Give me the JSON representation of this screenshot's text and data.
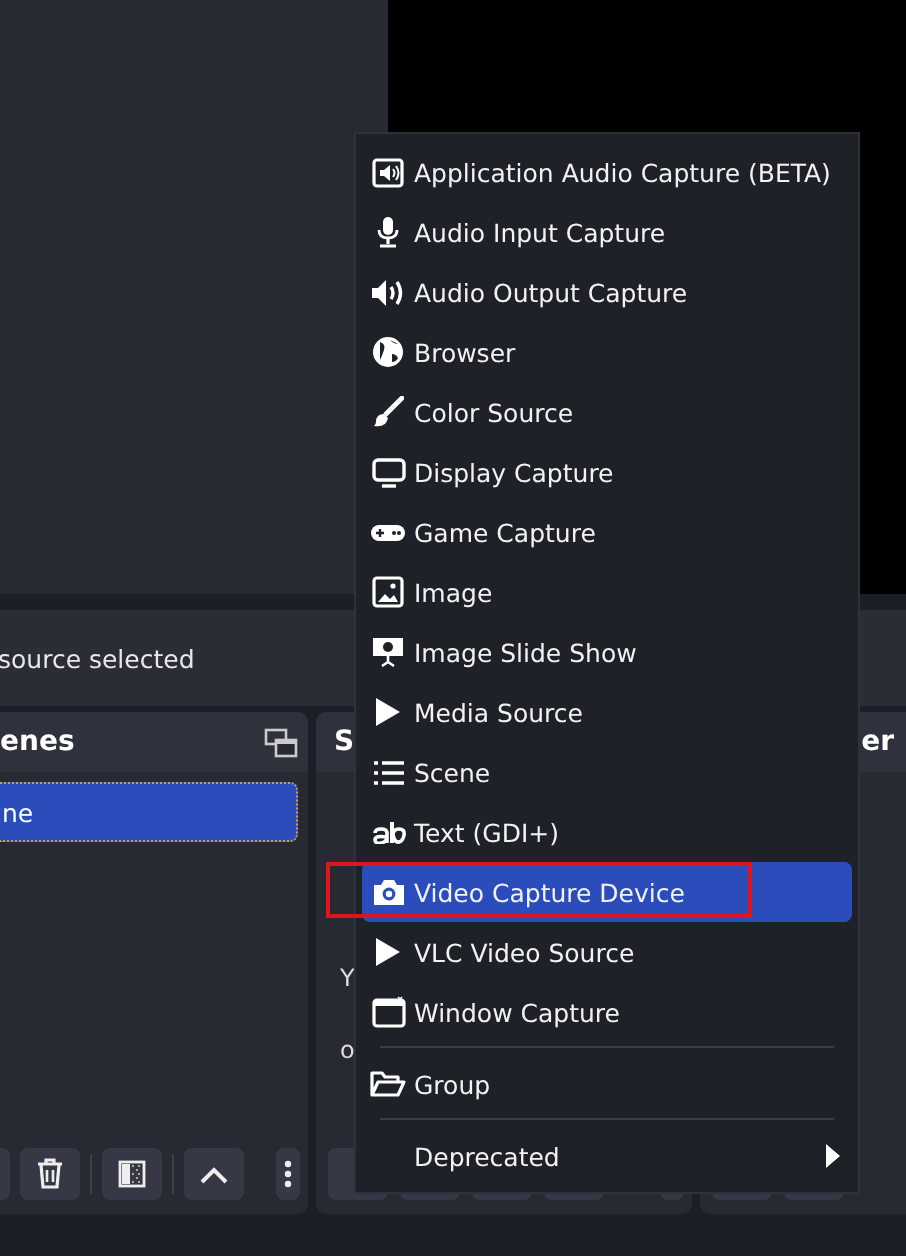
{
  "status": {
    "text": "source selected"
  },
  "panels": [
    {
      "kind": "scenes",
      "title": "enes",
      "items": [
        {
          "label": "ne",
          "selected": true
        }
      ]
    },
    {
      "kind": "sources",
      "title": "S",
      "lines": [
        "Y",
        "o"
      ]
    },
    {
      "kind": "mixer",
      "title": "er"
    }
  ],
  "menu": {
    "items": [
      {
        "kind": "item",
        "label": "Application Audio Capture (BETA)",
        "selected": false,
        "marked": false
      },
      {
        "kind": "item",
        "label": "Audio Input Capture",
        "selected": false,
        "marked": false
      },
      {
        "kind": "item",
        "label": "Audio Output Capture",
        "selected": false,
        "marked": false
      },
      {
        "kind": "item",
        "label": "Browser",
        "selected": false,
        "marked": false
      },
      {
        "kind": "item",
        "label": "Color Source",
        "selected": false,
        "marked": false
      },
      {
        "kind": "item",
        "label": "Display Capture",
        "selected": false,
        "marked": false
      },
      {
        "kind": "item",
        "label": "Game Capture",
        "selected": false,
        "marked": false
      },
      {
        "kind": "item",
        "label": "Image",
        "selected": false,
        "marked": false
      },
      {
        "kind": "item",
        "label": "Image Slide Show",
        "selected": false,
        "marked": false
      },
      {
        "kind": "item",
        "label": "Media Source",
        "selected": false,
        "marked": false
      },
      {
        "kind": "item",
        "label": "Scene",
        "selected": false,
        "marked": false
      },
      {
        "kind": "item",
        "label": "Text (GDI+)",
        "selected": false,
        "marked": false
      },
      {
        "kind": "item",
        "label": "Video Capture Device",
        "selected": true,
        "marked": true
      },
      {
        "kind": "item",
        "label": "VLC Video Source",
        "selected": false,
        "marked": false
      },
      {
        "kind": "item",
        "label": "Window Capture",
        "selected": false,
        "marked": false
      },
      {
        "kind": "separator"
      },
      {
        "kind": "item",
        "label": "Group",
        "selected": false,
        "marked": false
      },
      {
        "kind": "separator"
      },
      {
        "kind": "submenu",
        "label": "Deprecated",
        "selected": false,
        "marked": false
      }
    ]
  }
}
